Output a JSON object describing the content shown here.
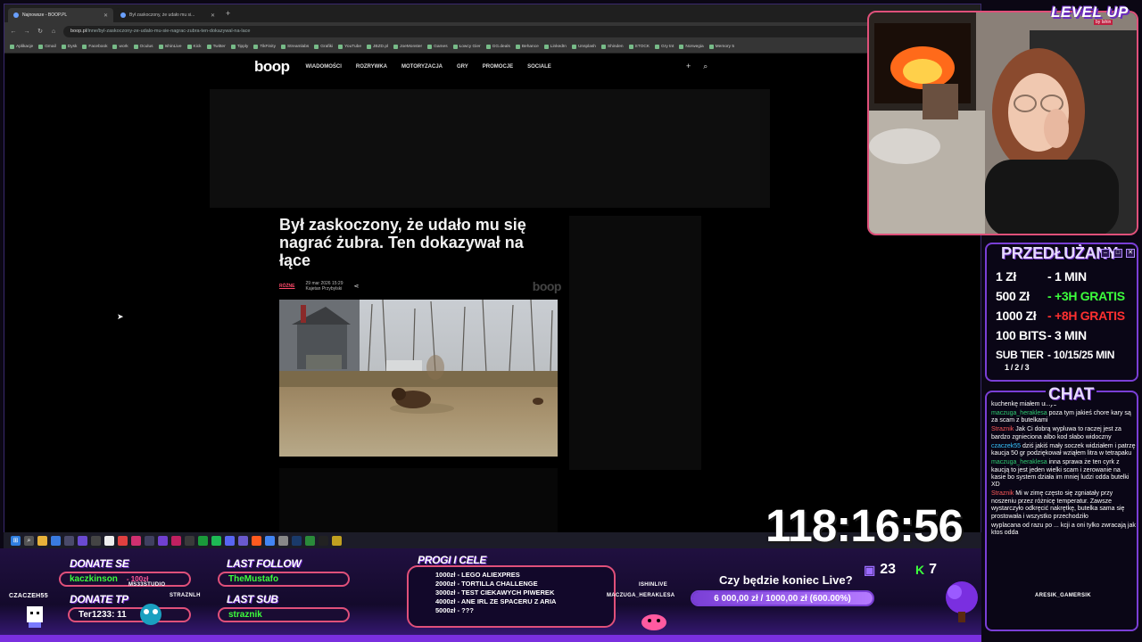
{
  "browser": {
    "tabs": [
      {
        "label": "Najnowsze - BOOP.PL",
        "active": true
      },
      {
        "label": "Był zaskoczony, że udało mu si...",
        "active": false
      }
    ],
    "url_host": "boop.pl",
    "url_path": "/inne/byl-zaskoczony-ze-udalo-mu-sie-nagrac-zubra-ten-dokazywal-na-lace",
    "bookmarks": [
      "Aplikacje",
      "Gmail",
      "Dysk",
      "Facebook",
      "work",
      "Oculus",
      "IshinLive",
      "Kick",
      "Twitter",
      "Tipply",
      "TikFinity",
      "Streamlabs",
      "Grafiki",
      "YouTube",
      "JBZD.pl",
      "JoeMonster",
      "Games",
      "Łowcy Gier",
      "GG.deals",
      "Behance",
      "LinkedIn",
      "Unsplash",
      "Shinden",
      "STOCK",
      "Gry tnt",
      "Norwegia",
      "Memory 5"
    ]
  },
  "site": {
    "logo": "boop",
    "nav": [
      "WIADOMOŚCI",
      "ROZRYWKA",
      "MOTORYZACJA",
      "GRY",
      "PROMOCJE",
      "SOCIALE"
    ],
    "headline": "Był zaskoczony, że udało mu się nagrać żubra. Ten dokazywał na łące",
    "category": "RÓŻNE",
    "date": "29 mar 2026 15:29",
    "author": "Kajetan Przybylski",
    "watermark": "boop"
  },
  "timer": "118:16:56",
  "overlay": {
    "level_up": "LEVEL UP",
    "level_up_sub": "by Ishin",
    "prolong": {
      "title": "PRZEDŁUŻANY",
      "rows": [
        {
          "key": "1 Zł",
          "val": "- 1 MIN",
          "color": "#ffffff"
        },
        {
          "key": "500 Zł",
          "val": "- +3H GRATIS",
          "color": "#3cff3c"
        },
        {
          "key": "1000 Zł",
          "val": "- +8H GRATIS",
          "color": "#ff3030"
        },
        {
          "key": "100 BITS",
          "val": "- 3 MIN",
          "color": "#ffffff"
        },
        {
          "key": "SUB TIER",
          "val": "- 10/15/25 MIN",
          "color": "#ffffff"
        }
      ],
      "sub_tiers": "1 / 2 / 3"
    },
    "chat_title": "CHAT",
    "chat": [
      {
        "user": "",
        "text": "kuchenkę miałem umyć",
        "cls": "u1"
      },
      {
        "user": "maczuga_heraklesa",
        "text": "poza tym jakieś chore kary są za scam z butelkami",
        "cls": "u1"
      },
      {
        "user": "Straznik",
        "text": "Jak Ci dobrą wypluwa to raczej jest za bardzo zgnieciona albo kod słabo widoczny",
        "cls": "u2"
      },
      {
        "user": "czaczek55",
        "text": "dziś jakiś mały soczek widziałem i patrzę kaucja 50 gr podziękował wziąłem litra w tetrapaku",
        "cls": "u3"
      },
      {
        "user": "maczuga_heraklesa",
        "text": "inna sprawa że ten cyrk z kaucją to jest jeden wielki scam i zerowanie na kasie bo system działa im mniej ludzi odda butelki XD",
        "cls": "u1"
      },
      {
        "user": "Straznik",
        "text": "Mi w zimę często się zgniatały przy noszeniu przez różnicę temperatur. Zawsze wystarczyło odkręcić nakrętkę, butelka sama się prostowała i wszystko przechodziło",
        "cls": "u2"
      },
      {
        "user": "",
        "text": "wyplacana od razu po ... kcji a oni tylko zwracają jak ktos odda",
        "cls": "u1"
      }
    ],
    "donate_se_label": "DONATE SE",
    "donate_se_name": "kaczkinson",
    "donate_se_amount": "- 100zł",
    "donate_tp_label": "DONATE TP",
    "donate_tp_name": "Ter1233: 11",
    "last_follow_label": "LAST FOLLOW",
    "last_follow_name": "TheMustafo",
    "last_sub_label": "LAST SUB",
    "last_sub_name": "straznik",
    "goals_label": "PROGI I CELE",
    "goals": [
      "1000zł - LEGO ALIEXPRES",
      "2000zł - TORTILLA CHALLENGE",
      "3000zł - TEST CIEKAWYCH PIWEREK",
      "4000zł - ANE IRL ZE SPACERU Z ARIA",
      "5000zł - ???"
    ],
    "live_question": "Czy będzie koniec Live?",
    "live_progress_text": "6 000,00 zł / 1000,00 zł (600.00%)",
    "live_progress": 1.0,
    "counter_a": "23",
    "counter_b": "7",
    "names": {
      "left_top": "CZACZEH55",
      "left_mid": "MS33STUDIO",
      "left_right": "STRAZNLH",
      "mid": "ISHINLIVE",
      "mid2": "MACZUGA_HERAKLESA",
      "right": "ARESIK_GAMERSIK"
    }
  },
  "colors": {
    "accent": "#7a3fd6",
    "pink": "#e0507a",
    "green": "#3cff3c",
    "red": "#ff3030"
  }
}
